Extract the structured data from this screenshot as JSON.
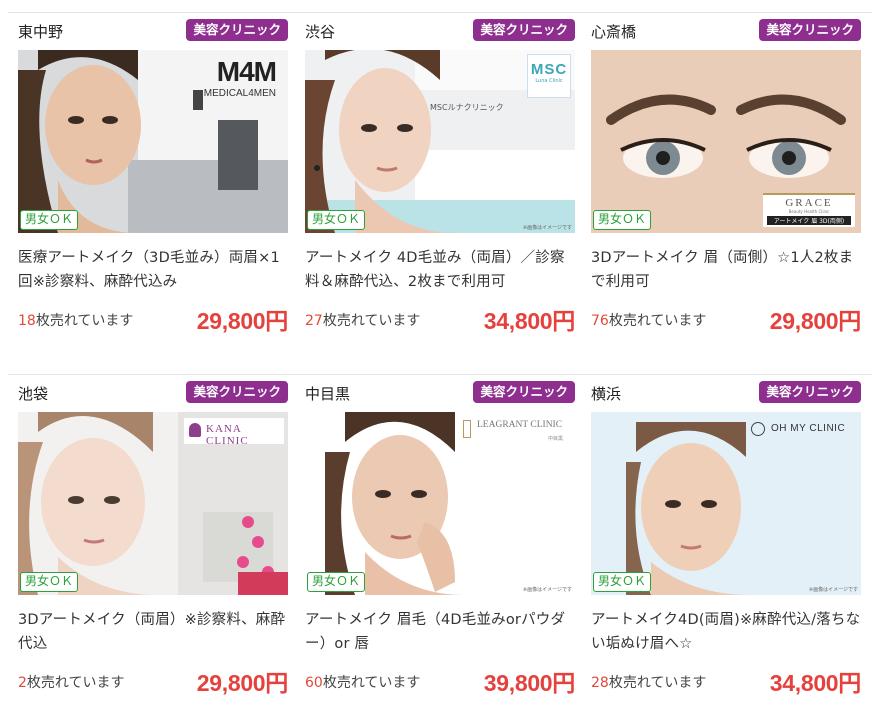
{
  "colors": {
    "category_bg": "#8e2f8f",
    "gender_green": "#2ca03a",
    "price_red": "#e5413d"
  },
  "listings": [
    {
      "location": "東中野",
      "category": "美容クリニック",
      "gender": "男女ＯＫ",
      "brand": "M4M",
      "brand_sub": "MEDICAL4MEN",
      "title": "医療アートメイク（3D毛並み）両眉×1回※診察料、麻酔代込み",
      "sold_count": "18",
      "sold_suffix": "枚売れています",
      "price": "29,800円"
    },
    {
      "location": "渋谷",
      "category": "美容クリニック",
      "gender": "男女ＯＫ",
      "brand": "MSC",
      "brand_sub": "Luna Clinic",
      "signage": "MSCルナクリニック",
      "note": "※画像はイメージです",
      "title": "アートメイク 4D毛並み（両眉）／診察料＆麻酔代込、2枚まで利用可",
      "sold_count": "27",
      "sold_suffix": "枚売れています",
      "price": "34,800円"
    },
    {
      "location": "心斎橋",
      "category": "美容クリニック",
      "gender": "男女ＯＫ",
      "brand": "GRACE",
      "brand_sub": "Beauty Health Clinic",
      "brand_caption": "アートメイク 眉 3D(両側)",
      "title": "3Dアートメイク 眉（両側）☆1人2枚まで利用可",
      "sold_count": "76",
      "sold_suffix": "枚売れています",
      "price": "29,800円"
    },
    {
      "location": "池袋",
      "category": "美容クリニック",
      "gender": "男女ＯＫ",
      "brand": "KANA CLINIC",
      "title": "3Dアートメイク（両眉）※診察料、麻酔代込",
      "sold_count": "2",
      "sold_suffix": "枚売れています",
      "price": "29,800円"
    },
    {
      "location": "中目黒",
      "category": "美容クリニック",
      "gender": "男女ＯＫ",
      "brand": "LEAGRANT CLINIC",
      "brand_sub": "中目黒",
      "note": "※画像はイメージです",
      "title": "アートメイク 眉毛（4D毛並みorパウダー）or 唇",
      "sold_count": "60",
      "sold_suffix": "枚売れています",
      "price": "39,800円"
    },
    {
      "location": "横浜",
      "category": "美容クリニック",
      "gender": "男女ＯＫ",
      "brand": "OH MY CLINIC",
      "note": "※画像はイメージです",
      "title": "アートメイク4D(両眉)※麻酔代込/落ちない垢ぬけ眉へ☆",
      "sold_count": "28",
      "sold_suffix": "枚売れています",
      "price": "34,800円"
    }
  ]
}
